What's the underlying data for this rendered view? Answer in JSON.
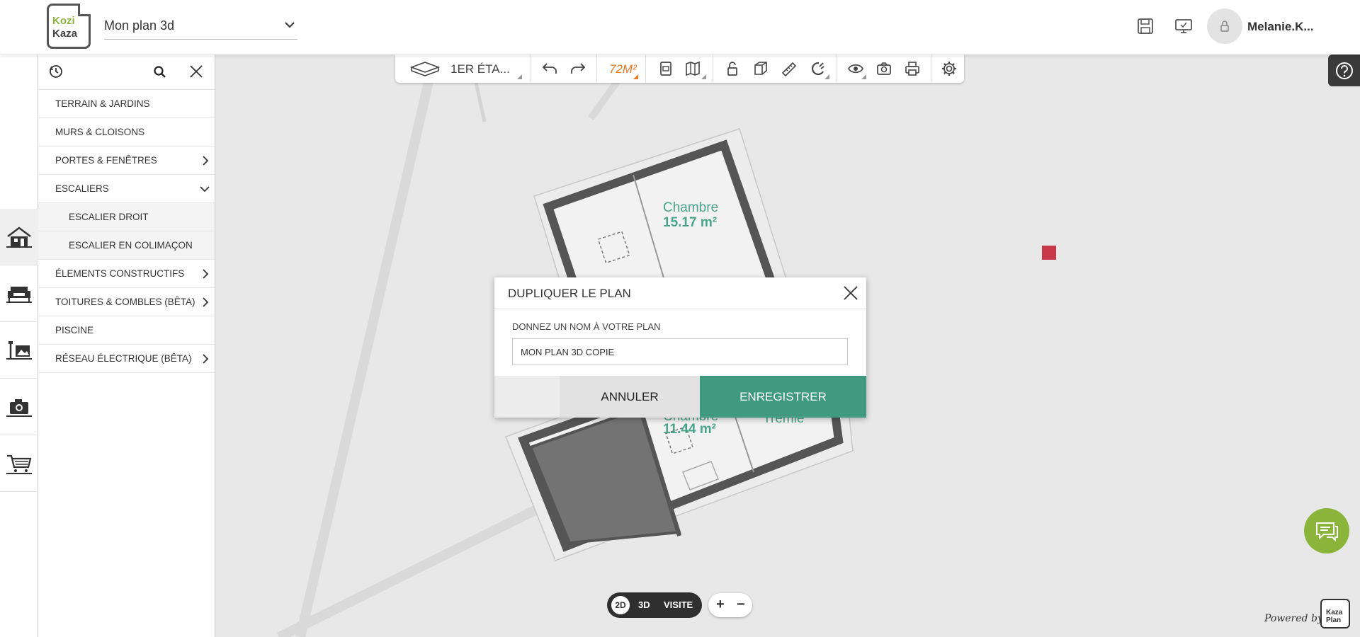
{
  "header": {
    "logo_top": "Kozi",
    "logo_bottom": "Kaza",
    "plan_name": "Mon plan 3d",
    "username": "Melanie.K..."
  },
  "rail": {
    "items": [
      {
        "icon": "house-icon"
      },
      {
        "icon": "sofa-icon"
      },
      {
        "icon": "decoration-icon"
      },
      {
        "icon": "camera-icon"
      },
      {
        "icon": "cart-icon"
      }
    ]
  },
  "sidebar": {
    "items": [
      {
        "label": "TERRAIN & JARDINS",
        "arrow": ""
      },
      {
        "label": "MURS & CLOISONS",
        "arrow": ""
      },
      {
        "label": "PORTES & FENÊTRES",
        "arrow": "right"
      },
      {
        "label": "ESCALIERS",
        "arrow": "down"
      },
      {
        "label": "ESCALIER DROIT",
        "sub": true
      },
      {
        "label": "ESCALIER EN COLIMAÇON",
        "sub": true
      },
      {
        "label": "ÉLEMENTS CONSTRUCTIFS",
        "arrow": "right"
      },
      {
        "label": "TOITURES & COMBLES (BÊTA)",
        "arrow": "right"
      },
      {
        "label": "PISCINE",
        "arrow": ""
      },
      {
        "label": "RÉSEAU ÉLECTRIQUE (BÊTA)",
        "arrow": "right"
      }
    ]
  },
  "toolbar": {
    "floor": "1ER ÉTA...",
    "area": "72M²"
  },
  "plan": {
    "room1_name": "Chambre",
    "room1_area": "15.17 m²",
    "room2_name": "Chambre",
    "room2_area": "11.44 m²",
    "room3_name": "Trémie"
  },
  "modal": {
    "title": "DUPLIQUER LE PLAN",
    "label": "DONNEZ UN NOM À VOTRE PLAN",
    "input_value": "MON PLAN 3D COPIE",
    "cancel": "ANNULER",
    "save": "ENREGISTRER"
  },
  "view": {
    "mode_2d": "2D",
    "mode_3d": "3D",
    "mode_visit": "VISITE",
    "zoom_in": "+",
    "zoom_out": "−"
  },
  "footer": {
    "powered_by": "Powered by",
    "kp_top": "Kaza",
    "kp_bottom": "Plan"
  },
  "colors": {
    "accent_green": "#3f9a80",
    "logo_green": "#8bb53a",
    "area_orange": "#e97a22",
    "marker_red": "#c8374a"
  }
}
